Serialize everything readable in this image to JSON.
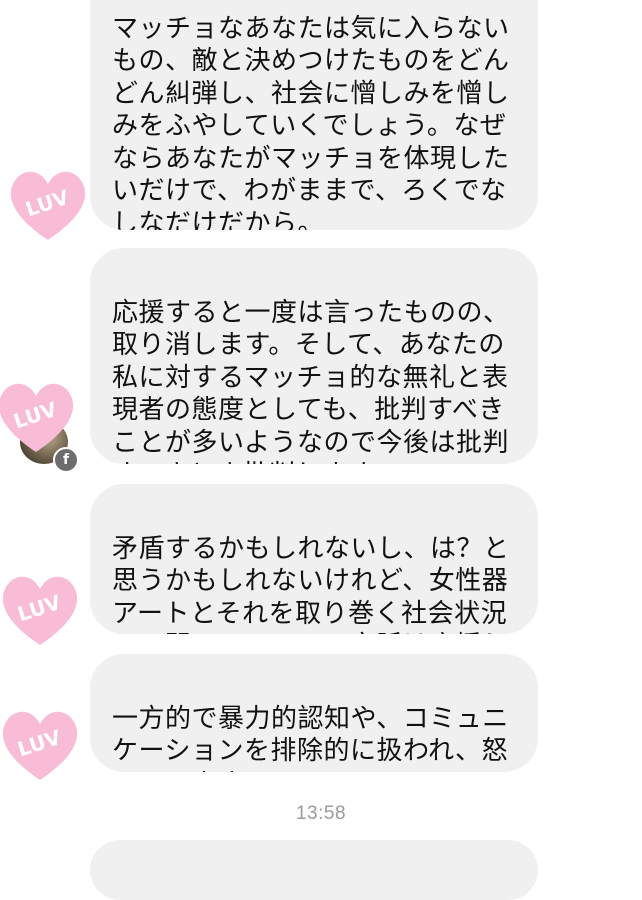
{
  "messages": [
    {
      "text": "マッチョなあなたは気に入らないもの、敵と決めつけたものをどんどん糾弾し、社会に憎しみを憎しみをふやしていくでしょう。なぜならあなたがマッチョを体現したいだけで、わがままで、ろくでなしなだけだから。"
    },
    {
      "text": "応援すると一度は言ったものの、取り消します。そして、あなたの私に対するマッチョ的な無礼と表現者の態度としても、批判すべきことが多いようなので今後は批判すべきとき批判します。"
    },
    {
      "text": "矛盾するかもしれないし、は？と思うかもしれないけれど、女性器アートとそれを取り巻く社会状況との闘いについての文脈は応援します。"
    },
    {
      "text": "一方的で暴力的認知や、コミュニケーションを排除的に扱われ、怒っています。"
    },
    {
      "text": ""
    }
  ],
  "avatar": {
    "sticker_text": "LUV",
    "heart_color": "#f9bcd6",
    "badge_glyph": "f"
  },
  "timestamp": "13:58"
}
